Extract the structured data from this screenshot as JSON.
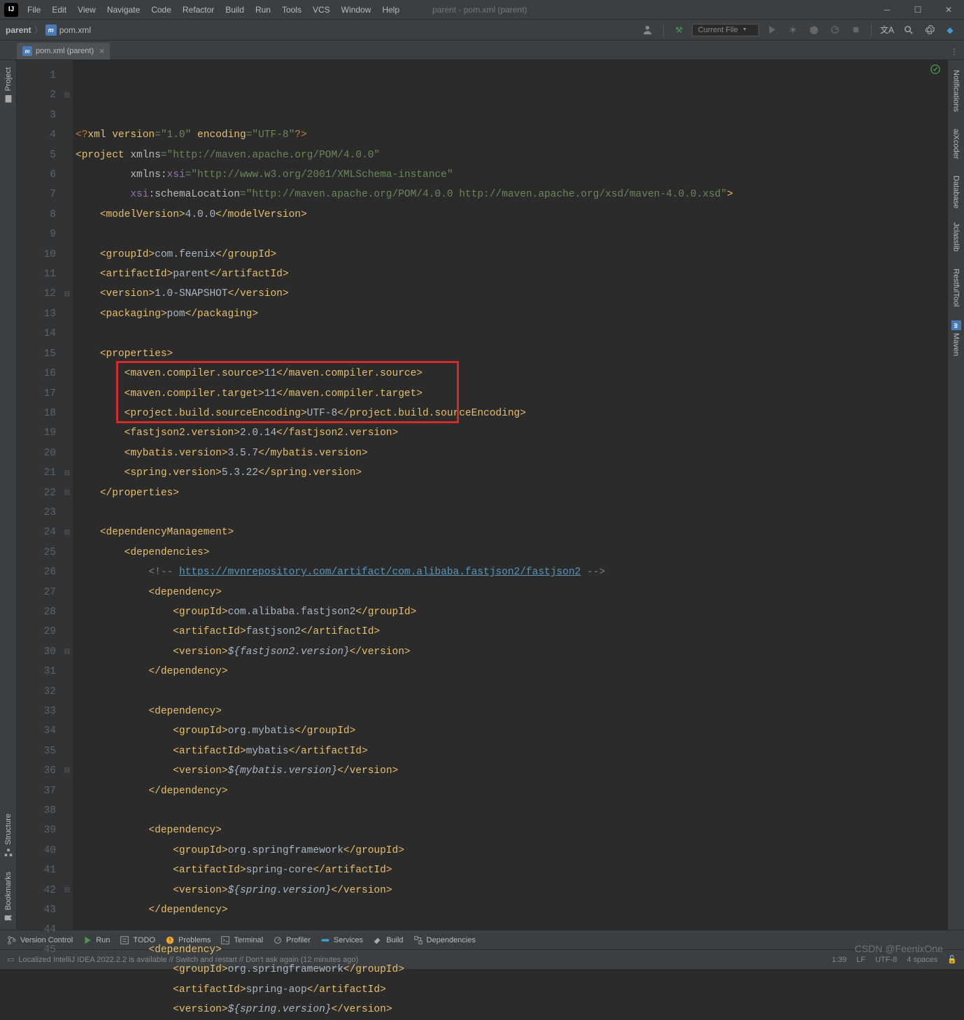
{
  "app": {
    "title": "parent - pom.xml (parent)"
  },
  "menu": {
    "file": "File",
    "edit": "Edit",
    "view": "View",
    "navigate": "Navigate",
    "code": "Code",
    "refactor": "Refactor",
    "build": "Build",
    "run": "Run",
    "tools": "Tools",
    "vcs": "VCS",
    "window": "Window",
    "help": "Help"
  },
  "breadcrumb": {
    "root": "parent",
    "file": "pom.xml"
  },
  "runcfg": "Current File",
  "tab": {
    "label": "pom.xml (parent)"
  },
  "left_tools": {
    "project": "Project",
    "structure": "Structure",
    "bookmarks": "Bookmarks"
  },
  "right_tools": {
    "notifications": "Notifications",
    "aixcoder": "aiXcoder",
    "database": "Database",
    "jclasslib": "Jclasslib",
    "restfultool": "RestfulTool",
    "maven": "Maven"
  },
  "bottom_tools": {
    "vc": "Version Control",
    "run": "Run",
    "todo": "TODO",
    "problems": "Problems",
    "terminal": "Terminal",
    "profiler": "Profiler",
    "services": "Services",
    "build": "Build",
    "deps": "Dependencies"
  },
  "status": {
    "msg": "Localized IntelliJ IDEA 2022.2.2 is available // Switch and restart // Don't ask again (12 minutes ago)",
    "pos": "1:39",
    "lf": "LF",
    "enc": "UTF-8",
    "indent": "4 spaces"
  },
  "watermark": "CSDN @FeenixOne",
  "foldable_lines": [
    2,
    12,
    21,
    22,
    24,
    30,
    36,
    42
  ],
  "code": {
    "line_start": 1,
    "line_end": 45,
    "tokens": [
      [
        {
          "c": "kw",
          "t": "<?"
        },
        {
          "c": "tag",
          "t": "xml version"
        },
        {
          "c": "str",
          "t": "=\"1.0\""
        },
        {
          "c": "tag",
          "t": " encoding"
        },
        {
          "c": "str",
          "t": "=\"UTF-8\""
        },
        {
          "c": "kw",
          "t": "?>"
        }
      ],
      [
        {
          "c": "tag",
          "t": "<project"
        },
        {
          "c": "attr",
          "t": " xmlns"
        },
        {
          "c": "str",
          "t": "=\"http://maven.apache.org/POM/4.0.0\""
        }
      ],
      [
        {
          "c": "",
          "t": "         "
        },
        {
          "c": "attr",
          "t": "xmlns:"
        },
        {
          "c": "attrns",
          "t": "xsi"
        },
        {
          "c": "str",
          "t": "=\"http://www.w3.org/2001/XMLSchema-instance\""
        }
      ],
      [
        {
          "c": "",
          "t": "         "
        },
        {
          "c": "attrns",
          "t": "xsi"
        },
        {
          "c": "attr",
          "t": ":schemaLocation"
        },
        {
          "c": "str",
          "t": "=\"http://maven.apache.org/POM/4.0.0 http://maven.apache.org/xsd/maven-4.0.0.xsd\""
        },
        {
          "c": "tag",
          "t": ">"
        }
      ],
      [
        {
          "c": "",
          "t": "    "
        },
        {
          "c": "tag",
          "t": "<modelVersion>"
        },
        {
          "c": "txt",
          "t": "4.0.0"
        },
        {
          "c": "tag",
          "t": "</modelVersion>"
        }
      ],
      [],
      [
        {
          "c": "",
          "t": "    "
        },
        {
          "c": "tag",
          "t": "<groupId>"
        },
        {
          "c": "txt",
          "t": "com.feenix"
        },
        {
          "c": "tag",
          "t": "</groupId>"
        }
      ],
      [
        {
          "c": "",
          "t": "    "
        },
        {
          "c": "tag",
          "t": "<artifactId>"
        },
        {
          "c": "txt",
          "t": "parent"
        },
        {
          "c": "tag",
          "t": "</artifactId>"
        }
      ],
      [
        {
          "c": "",
          "t": "    "
        },
        {
          "c": "tag",
          "t": "<version>"
        },
        {
          "c": "txt",
          "t": "1.0-SNAPSHOT"
        },
        {
          "c": "tag",
          "t": "</version>"
        }
      ],
      [
        {
          "c": "",
          "t": "    "
        },
        {
          "c": "tag",
          "t": "<packaging>"
        },
        {
          "c": "txt",
          "t": "pom"
        },
        {
          "c": "tag",
          "t": "</packaging>"
        }
      ],
      [],
      [
        {
          "c": "",
          "t": "    "
        },
        {
          "c": "tag",
          "t": "<properties>"
        }
      ],
      [
        {
          "c": "",
          "t": "        "
        },
        {
          "c": "tag",
          "t": "<maven.compiler.source>"
        },
        {
          "c": "txt",
          "t": "11"
        },
        {
          "c": "tag",
          "t": "</maven.compiler.source>"
        }
      ],
      [
        {
          "c": "",
          "t": "        "
        },
        {
          "c": "tag",
          "t": "<maven.compiler.target>"
        },
        {
          "c": "txt",
          "t": "11"
        },
        {
          "c": "tag",
          "t": "</maven.compiler.target>"
        }
      ],
      [
        {
          "c": "",
          "t": "        "
        },
        {
          "c": "tag",
          "t": "<project.build.sourceEncoding>"
        },
        {
          "c": "txt",
          "t": "UTF-8"
        },
        {
          "c": "tag",
          "t": "</project.build.sourceEncoding>"
        }
      ],
      [
        {
          "c": "",
          "t": "        "
        },
        {
          "c": "tag",
          "t": "<fastjson2.version>"
        },
        {
          "c": "txt",
          "t": "2.0.14"
        },
        {
          "c": "tag",
          "t": "</fastjson2.version>"
        }
      ],
      [
        {
          "c": "",
          "t": "        "
        },
        {
          "c": "tag",
          "t": "<mybatis.version>"
        },
        {
          "c": "txt",
          "t": "3.5.7"
        },
        {
          "c": "tag",
          "t": "</mybatis.version>"
        }
      ],
      [
        {
          "c": "",
          "t": "        "
        },
        {
          "c": "tag",
          "t": "<spring.version>"
        },
        {
          "c": "txt",
          "t": "5.3.22"
        },
        {
          "c": "tag",
          "t": "</spring.version>"
        }
      ],
      [
        {
          "c": "",
          "t": "    "
        },
        {
          "c": "tag",
          "t": "</properties>"
        }
      ],
      [],
      [
        {
          "c": "",
          "t": "    "
        },
        {
          "c": "tag",
          "t": "<dependencyManagement>"
        }
      ],
      [
        {
          "c": "",
          "t": "        "
        },
        {
          "c": "tag",
          "t": "<dependencies>"
        }
      ],
      [
        {
          "c": "",
          "t": "            "
        },
        {
          "c": "cmt",
          "t": "<!-- "
        },
        {
          "c": "link",
          "t": "https://mvnrepository.com/artifact/com.alibaba.fastjson2/fastjson2"
        },
        {
          "c": "cmt",
          "t": " -->"
        }
      ],
      [
        {
          "c": "",
          "t": "            "
        },
        {
          "c": "tag",
          "t": "<dependency>"
        }
      ],
      [
        {
          "c": "",
          "t": "                "
        },
        {
          "c": "tag",
          "t": "<groupId>"
        },
        {
          "c": "txt",
          "t": "com.alibaba.fastjson2"
        },
        {
          "c": "tag",
          "t": "</groupId>"
        }
      ],
      [
        {
          "c": "",
          "t": "                "
        },
        {
          "c": "tag",
          "t": "<artifactId>"
        },
        {
          "c": "txt",
          "t": "fastjson2"
        },
        {
          "c": "tag",
          "t": "</artifactId>"
        }
      ],
      [
        {
          "c": "",
          "t": "                "
        },
        {
          "c": "tag",
          "t": "<version>"
        },
        {
          "c": "var",
          "t": "${fastjson2.version}"
        },
        {
          "c": "tag",
          "t": "</version>"
        }
      ],
      [
        {
          "c": "",
          "t": "            "
        },
        {
          "c": "tag",
          "t": "</dependency>"
        }
      ],
      [],
      [
        {
          "c": "",
          "t": "            "
        },
        {
          "c": "tag",
          "t": "<dependency>"
        }
      ],
      [
        {
          "c": "",
          "t": "                "
        },
        {
          "c": "tag",
          "t": "<groupId>"
        },
        {
          "c": "txt",
          "t": "org.mybatis"
        },
        {
          "c": "tag",
          "t": "</groupId>"
        }
      ],
      [
        {
          "c": "",
          "t": "                "
        },
        {
          "c": "tag",
          "t": "<artifactId>"
        },
        {
          "c": "txt",
          "t": "mybatis"
        },
        {
          "c": "tag",
          "t": "</artifactId>"
        }
      ],
      [
        {
          "c": "",
          "t": "                "
        },
        {
          "c": "tag",
          "t": "<version>"
        },
        {
          "c": "var",
          "t": "${mybatis.version}"
        },
        {
          "c": "tag",
          "t": "</version>"
        }
      ],
      [
        {
          "c": "",
          "t": "            "
        },
        {
          "c": "tag",
          "t": "</dependency>"
        }
      ],
      [],
      [
        {
          "c": "",
          "t": "            "
        },
        {
          "c": "tag",
          "t": "<dependency>"
        }
      ],
      [
        {
          "c": "",
          "t": "                "
        },
        {
          "c": "tag",
          "t": "<groupId>"
        },
        {
          "c": "txt",
          "t": "org.springframework"
        },
        {
          "c": "tag",
          "t": "</groupId>"
        }
      ],
      [
        {
          "c": "",
          "t": "                "
        },
        {
          "c": "tag",
          "t": "<artifactId>"
        },
        {
          "c": "txt",
          "t": "spring-core"
        },
        {
          "c": "tag",
          "t": "</artifactId>"
        }
      ],
      [
        {
          "c": "",
          "t": "                "
        },
        {
          "c": "tag",
          "t": "<version>"
        },
        {
          "c": "var",
          "t": "${spring.version}"
        },
        {
          "c": "tag",
          "t": "</version>"
        }
      ],
      [
        {
          "c": "",
          "t": "            "
        },
        {
          "c": "tag",
          "t": "</dependency>"
        }
      ],
      [],
      [
        {
          "c": "",
          "t": "            "
        },
        {
          "c": "tag",
          "t": "<dependency>"
        }
      ],
      [
        {
          "c": "",
          "t": "                "
        },
        {
          "c": "tag",
          "t": "<groupId>"
        },
        {
          "c": "txt",
          "t": "org.springframework"
        },
        {
          "c": "tag",
          "t": "</groupId>"
        }
      ],
      [
        {
          "c": "",
          "t": "                "
        },
        {
          "c": "tag",
          "t": "<artifactId>"
        },
        {
          "c": "txt",
          "t": "spring-aop"
        },
        {
          "c": "tag",
          "t": "</artifactId>"
        }
      ],
      [
        {
          "c": "",
          "t": "                "
        },
        {
          "c": "tag",
          "t": "<version>"
        },
        {
          "c": "var",
          "t": "${spring.version}"
        },
        {
          "c": "tag",
          "t": "</version>"
        }
      ]
    ]
  },
  "redbox": {
    "top_line": 16,
    "bottom_line": 18
  }
}
